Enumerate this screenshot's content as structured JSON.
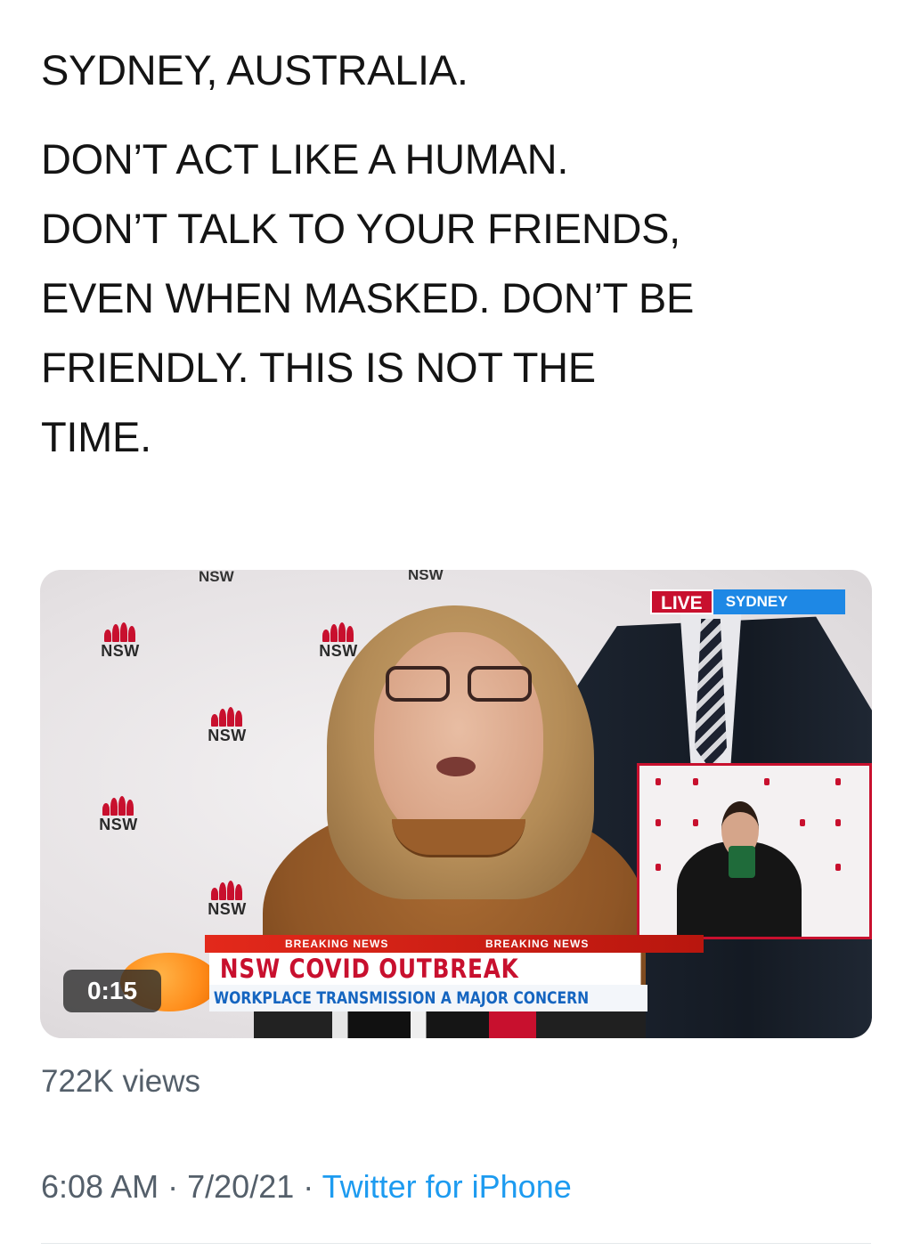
{
  "tweet": {
    "line1": "SYDNEY, AUSTRALIA.",
    "body_lines": [
      "DON’T ACT LIKE A HUMAN.",
      "DON’T TALK TO YOUR FRIENDS,",
      "EVEN WHEN MASKED. DON’T BE",
      "FRIENDLY. THIS IS NOT THE",
      "TIME."
    ]
  },
  "video": {
    "duration": "0:15",
    "live_label": "LIVE",
    "location_label": "SYDNEY",
    "breaking_left": "BREAKING NEWS",
    "breaking_right": "BREAKING NEWS",
    "headline": "NSW COVID OUTBREAK",
    "subheadline": "WORKPLACE TRANSMISSION A MAJOR CONCERN",
    "backdrop_logo_text": "NSW"
  },
  "stats": {
    "views": "722K views"
  },
  "meta": {
    "time": "6:08 AM",
    "separator": "·",
    "date": "7/20/21",
    "source": "Twitter for iPhone"
  },
  "colors": {
    "text": "#141414",
    "muted": "#545f6a",
    "link": "#1d9bf0",
    "nsw_red": "#c8102e"
  }
}
